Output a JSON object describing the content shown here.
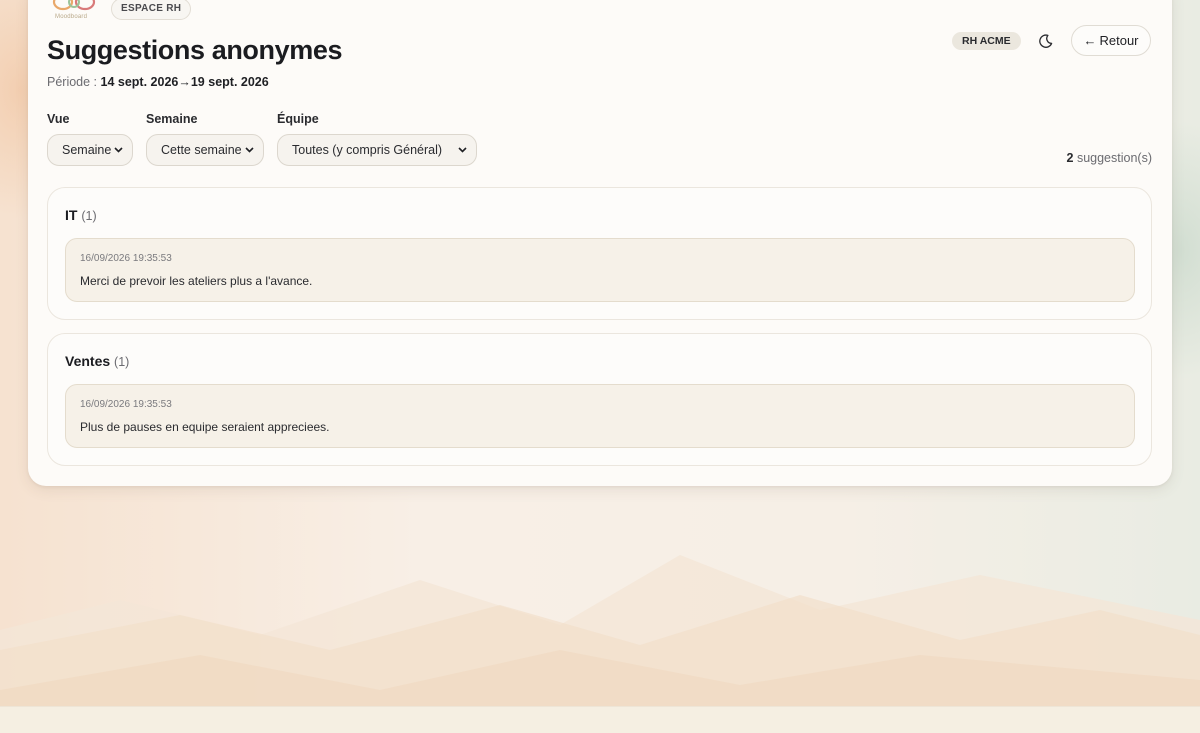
{
  "header": {
    "logo_text": "Moodboard",
    "space_tag": "ESPACE RH",
    "title": "Suggestions anonymes",
    "period_label": "Période :",
    "period_start": "14 sept. 2026",
    "period_arrow": "→",
    "period_end": "19 sept. 2026",
    "org_badge": "RH ACME",
    "theme_icon": "moon-icon",
    "back_arrow": "←",
    "back_label": "Retour"
  },
  "filters": {
    "view_label": "Vue",
    "view_value": "Semaine",
    "week_label": "Semaine",
    "week_value": "Cette semaine",
    "team_label": "Équipe",
    "team_value": "Toutes (y compris Général)",
    "chevron_icon": "chevron-down-icon"
  },
  "summary": {
    "count": "2",
    "count_label": "suggestion(s)"
  },
  "groups": [
    {
      "name": "IT",
      "count": "(1)",
      "items": [
        {
          "timestamp": "16/09/2026 19:35:53",
          "text": "Merci de prevoir les ateliers plus a l'avance."
        }
      ]
    },
    {
      "name": "Ventes",
      "count": "(1)",
      "items": [
        {
          "timestamp": "16/09/2026 19:35:53",
          "text": "Plus de pauses en equipe seraient appreciees."
        }
      ]
    }
  ],
  "colors": {
    "card_bg": "#fdfbf8",
    "item_bg": "#f6f1e8",
    "text_dark": "#1b1c20",
    "text_muted": "#6b6b70"
  }
}
